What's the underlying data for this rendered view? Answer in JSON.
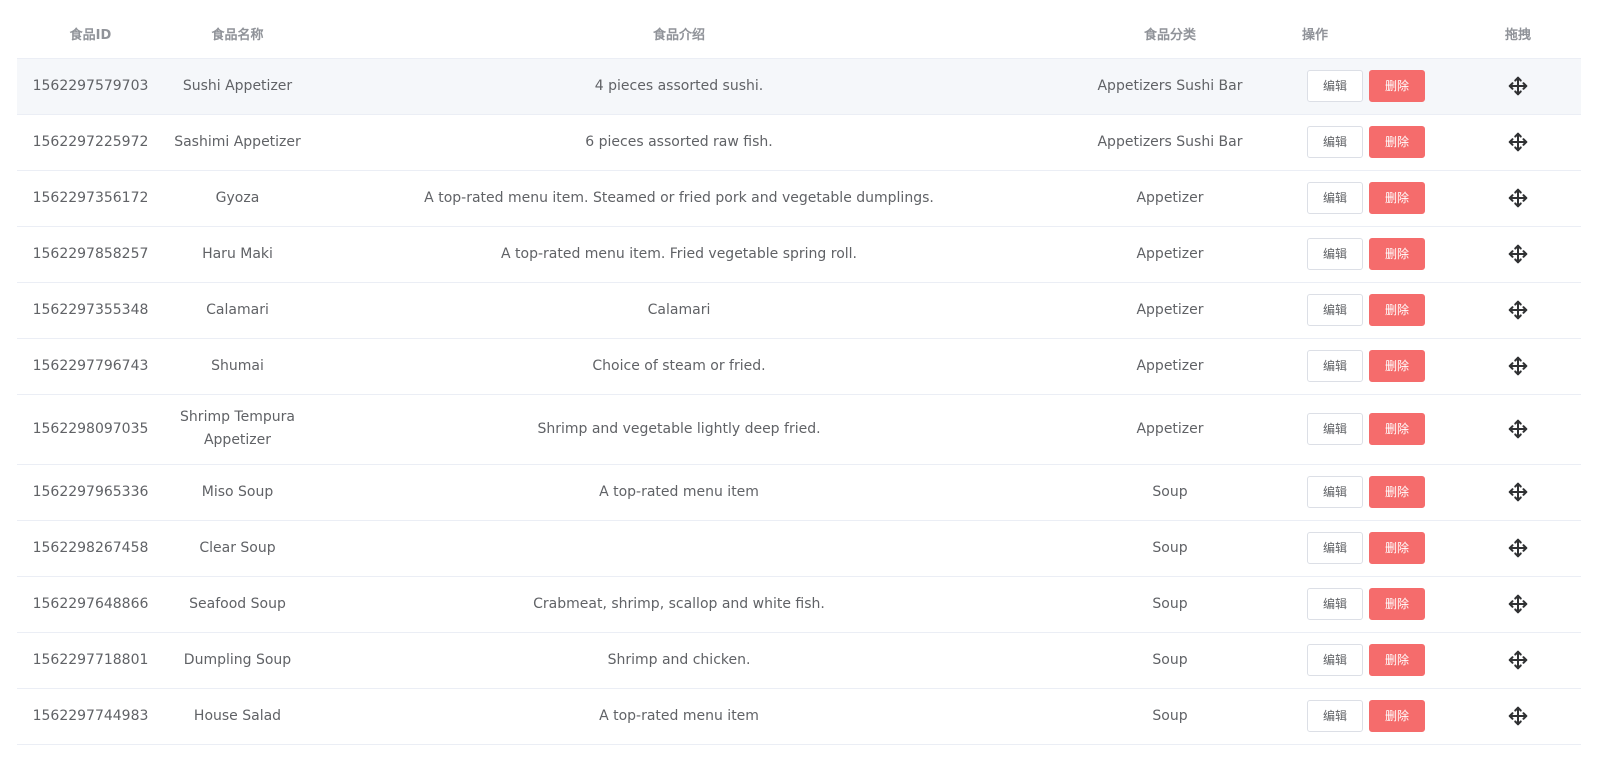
{
  "table": {
    "headers": {
      "id": "食品ID",
      "name": "食品名称",
      "desc": "食品介绍",
      "category": "食品分类",
      "ops": "操作",
      "drag": "拖拽"
    },
    "edit_label": "编辑",
    "delete_label": "删除",
    "drag_icon": "move-arrows-icon",
    "accent_delete": "#f56c6c",
    "rows": [
      {
        "id": "1562297579703",
        "name": "Sushi Appetizer",
        "desc": "4 pieces assorted sushi.",
        "category": "Appetizers Sushi Bar"
      },
      {
        "id": "1562297225972",
        "name": "Sashimi Appetizer",
        "desc": "6 pieces assorted raw fish.",
        "category": "Appetizers Sushi Bar"
      },
      {
        "id": "1562297356172",
        "name": "Gyoza",
        "desc": "A top-rated menu item. Steamed or fried pork and vegetable dumplings.",
        "category": "Appetizer"
      },
      {
        "id": "1562297858257",
        "name": "Haru Maki",
        "desc": "A top-rated menu item. Fried vegetable spring roll.",
        "category": "Appetizer"
      },
      {
        "id": "1562297355348",
        "name": "Calamari",
        "desc": "Calamari",
        "category": "Appetizer"
      },
      {
        "id": "1562297796743",
        "name": "Shumai",
        "desc": "Choice of steam or fried.",
        "category": "Appetizer"
      },
      {
        "id": "1562298097035",
        "name": "Shrimp Tempura Appetizer",
        "desc": "Shrimp and vegetable lightly deep fried.",
        "category": "Appetizer"
      },
      {
        "id": "1562297965336",
        "name": "Miso Soup",
        "desc": "A top-rated menu item",
        "category": "Soup"
      },
      {
        "id": "1562298267458",
        "name": "Clear Soup",
        "desc": "",
        "category": "Soup"
      },
      {
        "id": "1562297648866",
        "name": "Seafood Soup",
        "desc": "Crabmeat, shrimp, scallop and white fish.",
        "category": "Soup"
      },
      {
        "id": "1562297718801",
        "name": "Dumpling Soup",
        "desc": "Shrimp and chicken.",
        "category": "Soup"
      },
      {
        "id": "1562297744983",
        "name": "House Salad",
        "desc": "A top-rated menu item",
        "category": "Soup"
      }
    ]
  }
}
